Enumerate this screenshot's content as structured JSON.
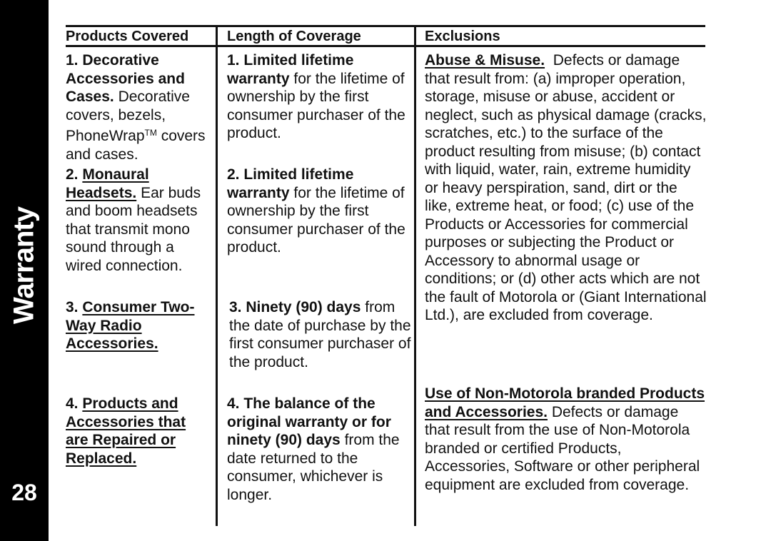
{
  "side_tab": {
    "section_label": "Warranty",
    "page_number": "28"
  },
  "table": {
    "headers": {
      "products": "Products Covered",
      "length": "Length of Coverage",
      "exclusions": "Exclusions"
    },
    "products": [
      {
        "num": "1.",
        "title": "Decorative Accessories and Cases.",
        "desc_pre": "Decorative covers, bezels, PhoneWrap",
        "tm": "TM",
        "desc_post": "covers and cases."
      },
      {
        "num": "2.",
        "title": "Monaural Headsets.",
        "desc": "Ear buds and boom headsets that transmit mono sound through a wired connection."
      },
      {
        "num": "3.",
        "title": "Consumer Two-Way Radio Accessories."
      },
      {
        "num": "4.",
        "title": "Products and Accessories that are Repaired or Replaced."
      }
    ],
    "coverage": [
      {
        "bold": "1. Limited lifetime warranty",
        "text": "for the lifetime of ownership by the first consumer purchaser of the product."
      },
      {
        "bold": "2. Limited lifetime warranty",
        "text": "for the lifetime of ownership by the first consumer purchaser of the product."
      },
      {
        "bold": "3. Ninety (90) days",
        "text": "from the date of purchase by the first consumer purchaser of the product."
      },
      {
        "bold": "4. The balance of the original warranty or for ninety (90) days",
        "text": "from the date returned to the consumer, whichever is longer."
      }
    ],
    "exclusions": [
      {
        "title": "Abuse & Misuse.",
        "text": "Defects or damage that result from: (a) improper operation, storage, misuse or abuse, accident or neglect, such as physical damage (cracks, scratches, etc.) to the surface of the product resulting from misuse; (b) contact with liquid, water, rain, extreme humidity or heavy perspiration, sand, dirt or the like, extreme heat, or food; (c) use of the Products or Accessories for commercial purposes or subjecting the Product or Accessory to abnormal usage or conditions; or (d) other acts which are not the fault of Motorola or (Giant International Ltd.), are excluded from coverage."
      },
      {
        "title": "Use of Non-Motorola branded Products and Accessories.",
        "text": "Defects or damage that result from the use of Non-Motorola branded or certified Products, Accessories, Software or other peripheral equipment are excluded from coverage."
      }
    ]
  }
}
